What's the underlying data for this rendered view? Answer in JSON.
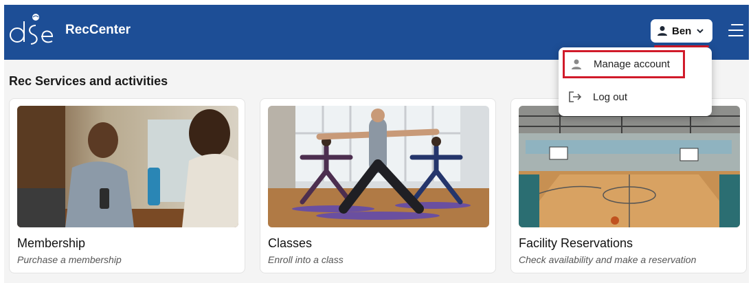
{
  "header": {
    "brand": "RecCenter",
    "user_name": "Ben",
    "bg_color": "#1d4e96"
  },
  "user_menu": {
    "items": [
      {
        "label": "Manage account",
        "icon": "person-icon"
      },
      {
        "label": "Log out",
        "icon": "logout-icon"
      }
    ]
  },
  "main": {
    "section_title": "Rec Services and activities",
    "cards": [
      {
        "title": "Membership",
        "subtitle": "Purchase a membership",
        "image": "membership-photo"
      },
      {
        "title": "Classes",
        "subtitle": "Enroll into a class",
        "image": "yoga-class-photo"
      },
      {
        "title": "Facility Reservations",
        "subtitle": "Check availability and make a reservation",
        "image": "gymnasium-photo"
      }
    ]
  },
  "colors": {
    "accent_red": "#d11a2a"
  }
}
